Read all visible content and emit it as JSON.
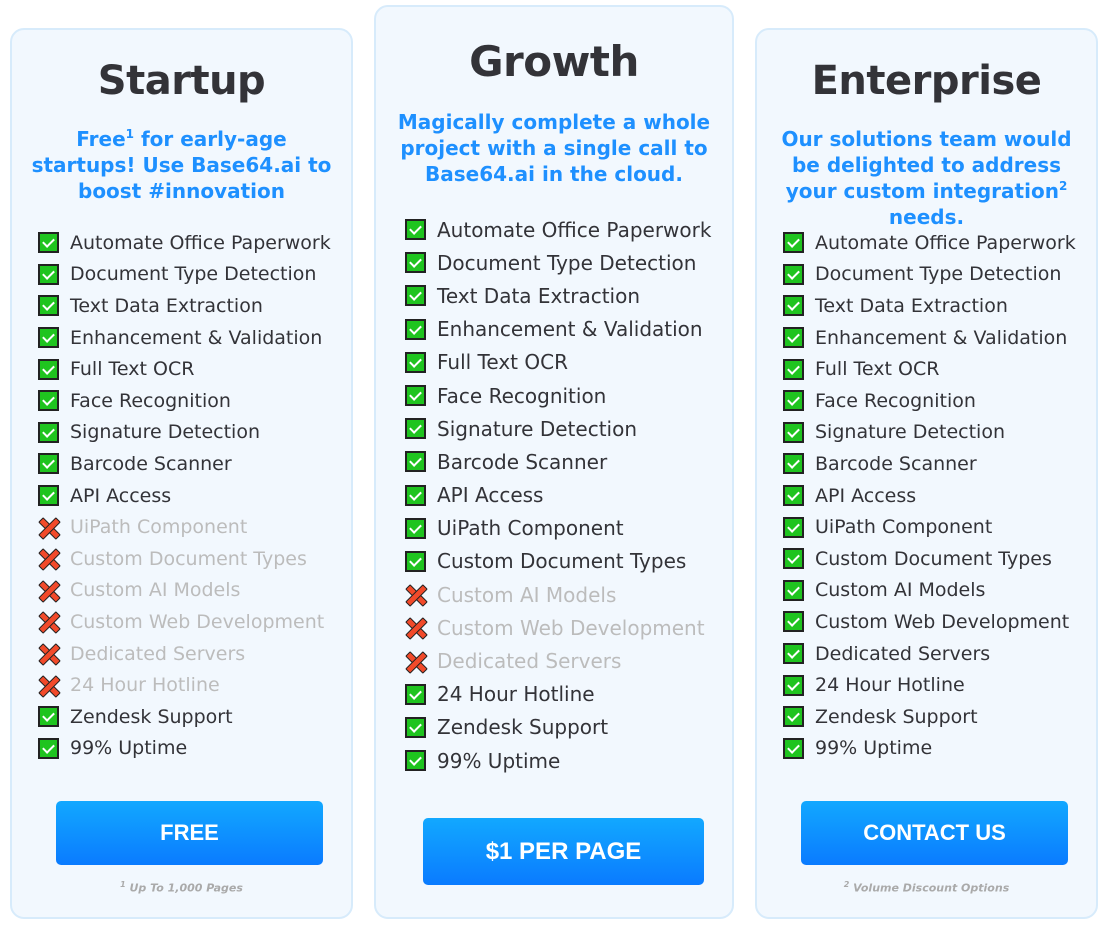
{
  "plans": [
    {
      "name": "Startup",
      "subtitle_parts": [
        "Free",
        "1",
        " for early-age startups! Use Base64.ai to boost #innovation"
      ],
      "features": [
        {
          "label": "Automate Office Paperwork",
          "included": true
        },
        {
          "label": "Document Type Detection",
          "included": true
        },
        {
          "label": "Text Data Extraction",
          "included": true
        },
        {
          "label": "Enhancement & Validation",
          "included": true
        },
        {
          "label": "Full Text OCR",
          "included": true
        },
        {
          "label": "Face Recognition",
          "included": true
        },
        {
          "label": "Signature Detection",
          "included": true
        },
        {
          "label": "Barcode Scanner",
          "included": true
        },
        {
          "label": "API Access",
          "included": true
        },
        {
          "label": "UiPath Component",
          "included": false
        },
        {
          "label": "Custom Document Types",
          "included": false
        },
        {
          "label": "Custom AI Models",
          "included": false
        },
        {
          "label": "Custom Web Development",
          "included": false
        },
        {
          "label": "Dedicated Servers",
          "included": false
        },
        {
          "label": "24 Hour Hotline",
          "included": false
        },
        {
          "label": "Zendesk Support",
          "included": true
        },
        {
          "label": "99% Uptime",
          "included": true
        }
      ],
      "cta_label": "FREE",
      "footnote_mark": "1",
      "footnote_text": " Up To 1,000 Pages"
    },
    {
      "name": "Growth",
      "subtitle_parts": [
        "Magically complete a whole project with a single call to Base64.ai in the cloud.",
        "",
        ""
      ],
      "features": [
        {
          "label": "Automate Office Paperwork",
          "included": true
        },
        {
          "label": "Document Type Detection",
          "included": true
        },
        {
          "label": "Text Data Extraction",
          "included": true
        },
        {
          "label": "Enhancement & Validation",
          "included": true
        },
        {
          "label": "Full Text OCR",
          "included": true
        },
        {
          "label": "Face Recognition",
          "included": true
        },
        {
          "label": "Signature Detection",
          "included": true
        },
        {
          "label": "Barcode Scanner",
          "included": true
        },
        {
          "label": "API Access",
          "included": true
        },
        {
          "label": "UiPath Component",
          "included": true
        },
        {
          "label": "Custom Document Types",
          "included": true
        },
        {
          "label": "Custom AI Models",
          "included": false
        },
        {
          "label": "Custom Web Development",
          "included": false
        },
        {
          "label": "Dedicated Servers",
          "included": false
        },
        {
          "label": "24 Hour Hotline",
          "included": true
        },
        {
          "label": "Zendesk Support",
          "included": true
        },
        {
          "label": "99% Uptime",
          "included": true
        }
      ],
      "cta_label": "$1 PER PAGE",
      "footnote_mark": "",
      "footnote_text": ""
    },
    {
      "name": "Enterprise",
      "subtitle_parts": [
        "Our solutions team would be delighted to address your custom integration",
        "2",
        " needs."
      ],
      "features": [
        {
          "label": "Automate Office Paperwork",
          "included": true
        },
        {
          "label": "Document Type Detection",
          "included": true
        },
        {
          "label": "Text Data Extraction",
          "included": true
        },
        {
          "label": "Enhancement & Validation",
          "included": true
        },
        {
          "label": "Full Text OCR",
          "included": true
        },
        {
          "label": "Face Recognition",
          "included": true
        },
        {
          "label": "Signature Detection",
          "included": true
        },
        {
          "label": "Barcode Scanner",
          "included": true
        },
        {
          "label": "API Access",
          "included": true
        },
        {
          "label": "UiPath Component",
          "included": true
        },
        {
          "label": "Custom Document Types",
          "included": true
        },
        {
          "label": "Custom AI Models",
          "included": true
        },
        {
          "label": "Custom Web Development",
          "included": true
        },
        {
          "label": "Dedicated Servers",
          "included": true
        },
        {
          "label": "24 Hour Hotline",
          "included": true
        },
        {
          "label": "Zendesk Support",
          "included": true
        },
        {
          "label": "99% Uptime",
          "included": true
        }
      ],
      "cta_label": "CONTACT US",
      "footnote_mark": "2",
      "footnote_text": " Volume Discount Options"
    }
  ],
  "colors": {
    "card_bg": "#f2f8fe",
    "card_border": "#d7ebfb",
    "accent": "#1e90ff",
    "button_top": "#12a8ff",
    "button_bottom": "#0a7bff",
    "check_green": "#1fc41f",
    "cross_red": "#f24a2a",
    "title": "#333338",
    "disabled_text": "#bcbcbc"
  }
}
